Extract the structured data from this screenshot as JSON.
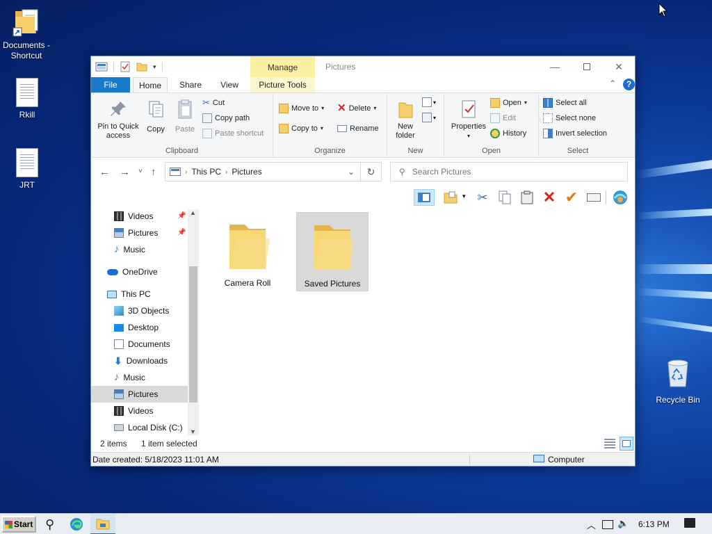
{
  "desktop": {
    "icons": [
      {
        "label": "Documents - Shortcut",
        "icon": "folder-shortcut-icon"
      },
      {
        "label": "Rkill",
        "icon": "text-file-icon"
      },
      {
        "label": "JRT",
        "icon": "text-file-icon"
      },
      {
        "label": "Recycle Bin",
        "icon": "recycle-bin-icon"
      }
    ]
  },
  "window": {
    "title": "Pictures",
    "contextual_tab_group": "Manage",
    "tabs": [
      "File",
      "Home",
      "Share",
      "View",
      "Picture Tools"
    ],
    "active_tab": "Home"
  },
  "ribbon": {
    "clipboard": {
      "label": "Clipboard",
      "pin": "Pin to Quick access",
      "copy": "Copy",
      "paste": "Paste",
      "cut": "Cut",
      "copy_path": "Copy path",
      "paste_shortcut": "Paste shortcut"
    },
    "organize": {
      "label": "Organize",
      "move_to": "Move to",
      "copy_to": "Copy to",
      "delete": "Delete",
      "rename": "Rename"
    },
    "new": {
      "label": "New",
      "new_folder": "New folder"
    },
    "open": {
      "label": "Open",
      "properties": "Properties",
      "open": "Open",
      "edit": "Edit",
      "history": "History"
    },
    "select": {
      "label": "Select",
      "select_all": "Select all",
      "select_none": "Select none",
      "invert": "Invert selection"
    }
  },
  "address": {
    "breadcrumb": [
      "This PC",
      "Pictures"
    ],
    "search_placeholder": "Search Pictures"
  },
  "nav": {
    "items": [
      {
        "label": "Videos",
        "icon": "videos-icon",
        "pinned": true
      },
      {
        "label": "Pictures",
        "icon": "pictures-icon",
        "pinned": true
      },
      {
        "label": "Music",
        "icon": "music-icon"
      },
      {
        "label": "OneDrive",
        "icon": "onedrive-icon"
      },
      {
        "label": "This PC",
        "icon": "this-pc-icon"
      },
      {
        "label": "3D Objects",
        "icon": "3d-objects-icon"
      },
      {
        "label": "Desktop",
        "icon": "desktop-icon"
      },
      {
        "label": "Documents",
        "icon": "documents-icon"
      },
      {
        "label": "Downloads",
        "icon": "downloads-icon"
      },
      {
        "label": "Music",
        "icon": "music-icon"
      },
      {
        "label": "Pictures",
        "icon": "pictures-icon",
        "selected": true
      },
      {
        "label": "Videos",
        "icon": "videos-icon"
      },
      {
        "label": "Local Disk (C:)",
        "icon": "local-disk-icon"
      }
    ]
  },
  "content": {
    "folders": [
      {
        "name": "Camera Roll",
        "selected": false
      },
      {
        "name": "Saved Pictures",
        "selected": true
      }
    ]
  },
  "status": {
    "item_count": "2 items",
    "selection": "1 item selected",
    "date_created": "Date created: 5/18/2023 11:01 AM",
    "location": "Computer"
  },
  "taskbar": {
    "start_label": "Start",
    "time": "6:13 PM"
  },
  "colors": {
    "file_tab": "#1979ca",
    "manage_tab": "#f9f0a2",
    "selection": "#cce8ff",
    "folder": "#f8d775"
  }
}
